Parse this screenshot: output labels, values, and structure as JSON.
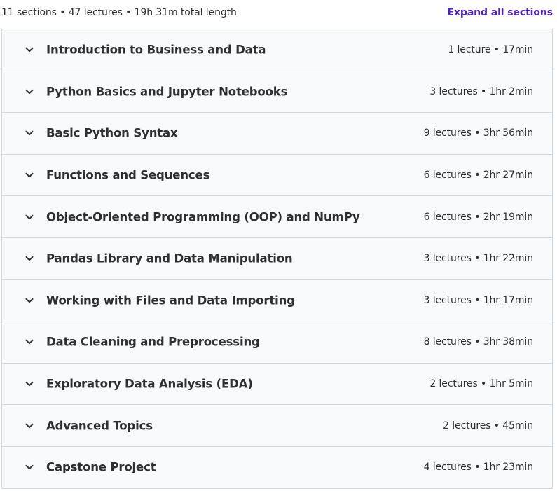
{
  "summary": {
    "text": "11 sections • 47 lectures • 19h 31m total length",
    "expand_label": "Expand all sections"
  },
  "sections": [
    {
      "title": "Introduction to Business and Data",
      "meta": "1 lecture • 17min"
    },
    {
      "title": "Python Basics and Jupyter Notebooks",
      "meta": "3 lectures • 1hr 2min"
    },
    {
      "title": "Basic Python Syntax",
      "meta": "9 lectures • 3hr 56min"
    },
    {
      "title": "Functions and Sequences",
      "meta": "6 lectures • 2hr 27min"
    },
    {
      "title": "Object-Oriented Programming (OOP) and NumPy",
      "meta": "6 lectures • 2hr 19min"
    },
    {
      "title": "Pandas Library and Data Manipulation",
      "meta": "3 lectures • 1hr 22min"
    },
    {
      "title": "Working with Files and Data Importing",
      "meta": "3 lectures • 1hr 17min"
    },
    {
      "title": "Data Cleaning and Preprocessing",
      "meta": "8 lectures • 3hr 38min"
    },
    {
      "title": "Exploratory Data Analysis (EDA)",
      "meta": "2 lectures • 1hr 5min"
    },
    {
      "title": "Advanced Topics",
      "meta": "2 lectures • 45min"
    },
    {
      "title": "Capstone Project",
      "meta": "4 lectures • 1hr 23min"
    }
  ],
  "icons": {
    "section_toggle": "chevron-down-icon"
  },
  "colors": {
    "link": "#5022c3",
    "row_background": "#f7f9fa",
    "border": "#d1d7dc",
    "text": "#2d2f31"
  }
}
